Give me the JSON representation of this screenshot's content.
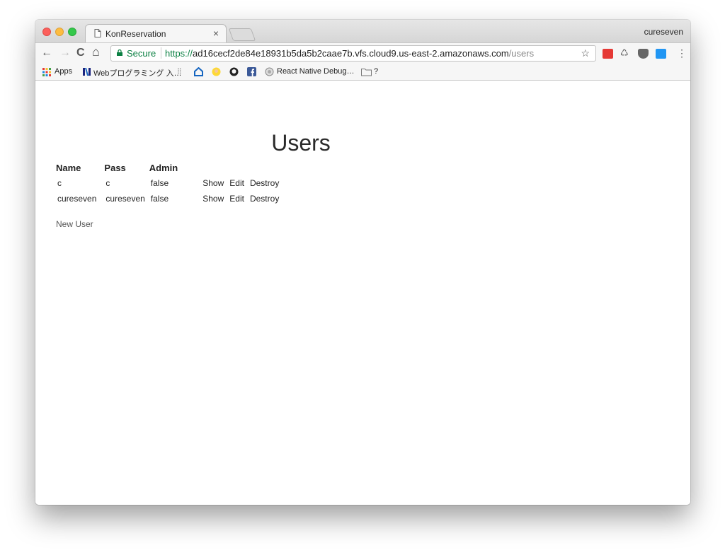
{
  "window": {
    "profile_name": "cureseven"
  },
  "tab": {
    "title": "KonReservation",
    "close_label": "×"
  },
  "toolbar": {
    "security_label": "Secure",
    "url_scheme": "https://",
    "url_host": "ad16cecf2de84e18931b5da5b2caae7b.vfs.cloud9.us-east-2.amazonaws.com",
    "url_path": "/users",
    "back_icon": "←",
    "forward_icon": "→",
    "reload_icon": "C",
    "home_icon": "⌂",
    "star_icon": "☆",
    "menu_icon": "⋮"
  },
  "bookmarks": {
    "apps": "Apps",
    "web_programming": "Webプログラミング 入…",
    "react_native": "React Native Debug…",
    "folder": "?"
  },
  "page": {
    "title": "Users",
    "columns": [
      "Name",
      "Pass",
      "Admin"
    ],
    "rows": [
      {
        "name": "c",
        "pass": "c",
        "admin": "false",
        "show": "Show",
        "edit": "Edit",
        "destroy": "Destroy"
      },
      {
        "name": "cureseven",
        "pass": "cureseven",
        "admin": "false",
        "show": "Show",
        "edit": "Edit",
        "destroy": "Destroy"
      }
    ],
    "new_user_link": "New User"
  },
  "colors": {
    "secure_green": "#0b8043",
    "close_red": "#fc605c",
    "minimize_yellow": "#fdbc40",
    "maximize_green": "#34c84a"
  }
}
